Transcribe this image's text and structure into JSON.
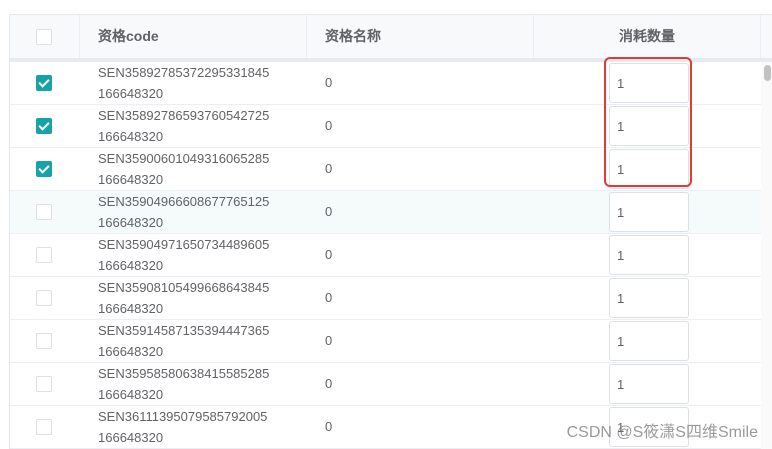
{
  "header": {
    "select_all_checked": false,
    "col_code": "资格code",
    "col_name": "资格名称",
    "col_qty": "消耗数量"
  },
  "rows": [
    {
      "code_line1": "SEN35892785372295331845",
      "code_line2": "166648320",
      "name": "0",
      "qty": "1",
      "checked": true
    },
    {
      "code_line1": "SEN35892786593760542725",
      "code_line2": "166648320",
      "name": "0",
      "qty": "1",
      "checked": true
    },
    {
      "code_line1": "SEN35900601049316065285",
      "code_line2": "166648320",
      "name": "0",
      "qty": "1",
      "checked": true
    },
    {
      "code_line1": "SEN35904966608677765125",
      "code_line2": "166648320",
      "name": "0",
      "qty": "1",
      "checked": false
    },
    {
      "code_line1": "SEN35904971650734489605",
      "code_line2": "166648320",
      "name": "0",
      "qty": "1",
      "checked": false
    },
    {
      "code_line1": "SEN35908105499668643845",
      "code_line2": "166648320",
      "name": "0",
      "qty": "1",
      "checked": false
    },
    {
      "code_line1": "SEN35914587135394447365",
      "code_line2": "166648320",
      "name": "0",
      "qty": "1",
      "checked": false
    },
    {
      "code_line1": "SEN35958580638415585285",
      "code_line2": "166648320",
      "name": "0",
      "qty": "1",
      "checked": false
    },
    {
      "code_line1": "SEN36111395079585792005",
      "code_line2": "166648320",
      "name": "0",
      "qty": "1",
      "checked": false
    }
  ],
  "watermark": "CSDN @S筱潇S四维Smile",
  "colors": {
    "accent": "#17a2a8",
    "highlight": "#e53935"
  }
}
